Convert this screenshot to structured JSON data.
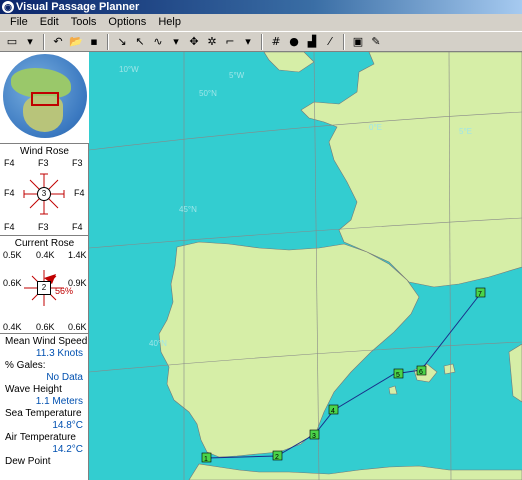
{
  "window": {
    "title": "Visual Passage Planner"
  },
  "menu": [
    "File",
    "Edit",
    "Tools",
    "Options",
    "Help"
  ],
  "toolbar": {
    "buttons": [
      "new-document",
      "open-folder",
      "save",
      "select-tool",
      "add-waypoint",
      "route-tool",
      "grid",
      "globe",
      "chart",
      "settings"
    ]
  },
  "wind_rose": {
    "title": "Wind Rose",
    "top_left": "F4",
    "top_center": "F3",
    "top_right": "F3",
    "mid_left": "F4",
    "mid_right": "F4",
    "center": "3",
    "bot_left": "F4",
    "bot_center": "F3",
    "bot_right": "F4"
  },
  "current_rose": {
    "title": "Current Rose",
    "top_left": "0.5K",
    "top_center": "0.4K",
    "top_right": "1.4K",
    "mid_left": "0.6K",
    "mid_right": "0.9K",
    "center": "2",
    "center_right": "56%",
    "bot_left": "0.4K",
    "bot_center": "0.6K",
    "bot_right": "0.6K"
  },
  "stats": [
    {
      "label": "Mean Wind Speed",
      "value": "11.3 Knots"
    },
    {
      "label": "% Gales:",
      "value": "No Data"
    },
    {
      "label": "Wave Height",
      "value": "1.1 Meters"
    },
    {
      "label": "Sea Temperature",
      "value": "14.8°C"
    },
    {
      "label": "Air Temperature",
      "value": "14.2°C"
    },
    {
      "label": "Dew Point",
      "value": ""
    }
  ],
  "map": {
    "grid_labels": [
      "10°W",
      "5°W",
      "50°N",
      "45°N",
      "5°E",
      "0°E",
      "40°N"
    ],
    "waypoints": [
      "1",
      "2",
      "3",
      "4",
      "5",
      "6",
      "7"
    ],
    "colors": {
      "sea": "#33cdd0",
      "land": "#d6eea7",
      "route": "#1a2e8a",
      "waypoint": "#4ad44a"
    }
  }
}
